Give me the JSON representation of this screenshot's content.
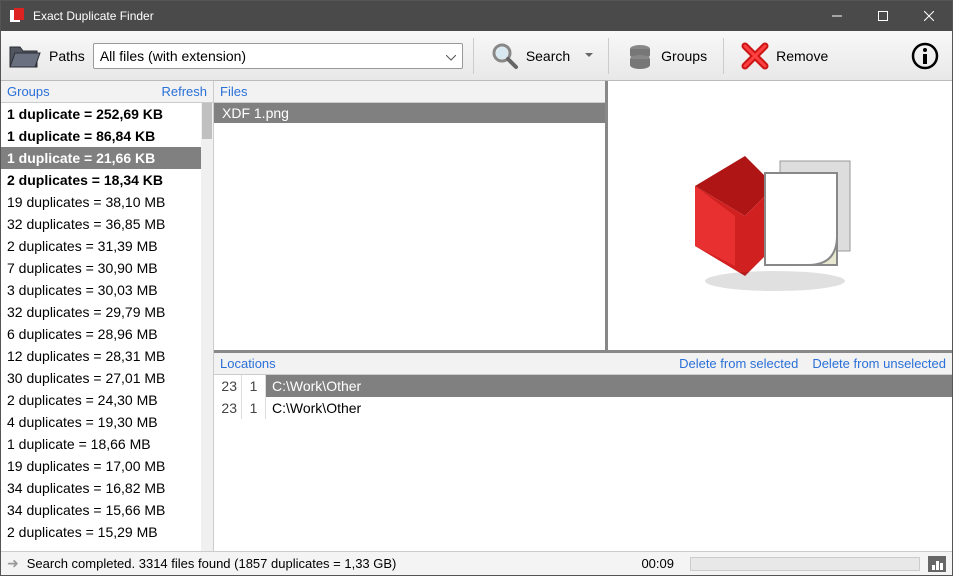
{
  "titlebar": {
    "title": "Exact Duplicate Finder"
  },
  "toolbar": {
    "paths_label": "Paths",
    "paths_value": "All files (with extension)",
    "search_label": "Search",
    "groups_label": "Groups",
    "remove_label": "Remove"
  },
  "groups_panel": {
    "title": "Groups",
    "refresh": "Refresh",
    "items": [
      {
        "text": "1 duplicate = 252,69 KB",
        "bold": true,
        "selected": false
      },
      {
        "text": "1 duplicate = 86,84 KB",
        "bold": true,
        "selected": false
      },
      {
        "text": "1 duplicate = 21,66 KB",
        "bold": true,
        "selected": true
      },
      {
        "text": "2 duplicates = 18,34 KB",
        "bold": true,
        "selected": false
      },
      {
        "text": "19 duplicates = 38,10 MB",
        "bold": false,
        "selected": false
      },
      {
        "text": "32 duplicates = 36,85 MB",
        "bold": false,
        "selected": false
      },
      {
        "text": "2 duplicates = 31,39 MB",
        "bold": false,
        "selected": false
      },
      {
        "text": "7 duplicates = 30,90 MB",
        "bold": false,
        "selected": false
      },
      {
        "text": "3 duplicates = 30,03 MB",
        "bold": false,
        "selected": false
      },
      {
        "text": "32 duplicates = 29,79 MB",
        "bold": false,
        "selected": false
      },
      {
        "text": "6 duplicates = 28,96 MB",
        "bold": false,
        "selected": false
      },
      {
        "text": "12 duplicates = 28,31 MB",
        "bold": false,
        "selected": false
      },
      {
        "text": "30 duplicates = 27,01 MB",
        "bold": false,
        "selected": false
      },
      {
        "text": "2 duplicates = 24,30 MB",
        "bold": false,
        "selected": false
      },
      {
        "text": "4 duplicates = 19,30 MB",
        "bold": false,
        "selected": false
      },
      {
        "text": "1 duplicate = 18,66 MB",
        "bold": false,
        "selected": false
      },
      {
        "text": "19 duplicates = 17,00 MB",
        "bold": false,
        "selected": false
      },
      {
        "text": "34 duplicates = 16,82 MB",
        "bold": false,
        "selected": false
      },
      {
        "text": "34 duplicates = 15,66 MB",
        "bold": false,
        "selected": false
      },
      {
        "text": "2 duplicates = 15,29 MB",
        "bold": false,
        "selected": false
      }
    ]
  },
  "files_panel": {
    "title": "Files",
    "items": [
      {
        "name": "XDF 1.png",
        "selected": true
      }
    ]
  },
  "locations_panel": {
    "title": "Locations",
    "delete_selected": "Delete from selected",
    "delete_unselected": "Delete from unselected",
    "rows": [
      {
        "a": "23",
        "b": "1",
        "path": "C:\\Work\\Other",
        "selected": true
      },
      {
        "a": "23",
        "b": "1",
        "path": "C:\\Work\\Other",
        "selected": false
      }
    ]
  },
  "statusbar": {
    "message": "Search completed. 3314 files found (1857 duplicates = 1,33 GB)",
    "time": "00:09"
  }
}
